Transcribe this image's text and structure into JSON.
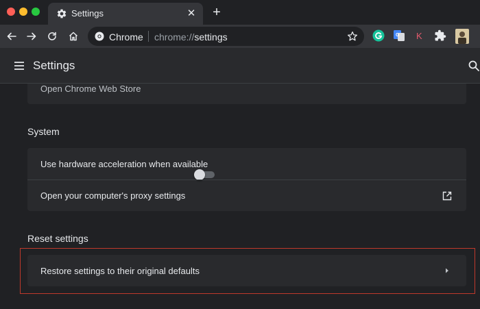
{
  "colors": {
    "background": "#202124",
    "toolbar": "#35363a",
    "card": "#292a2d",
    "highlight_border": "#c0392b",
    "traffic_red": "#fe5f57",
    "traffic_yellow": "#febc2e",
    "traffic_green": "#28c840"
  },
  "window": {
    "controls": [
      "close",
      "minimize",
      "zoom"
    ]
  },
  "tab": {
    "title": "Settings",
    "icon": "gear-icon",
    "close_label": "✕"
  },
  "new_tab_label": "+",
  "toolbar": {
    "buttons": [
      "back-arrow-icon",
      "forward-arrow-icon",
      "reload-icon",
      "home-icon"
    ],
    "omnibox": {
      "origin": "Chrome",
      "url_scheme": "chrome://",
      "url_host": "settings"
    },
    "extensions": [
      "grammarly-icon",
      "google-translate-icon",
      "k-extension-icon",
      "extensions-puzzle-icon",
      "profile-avatar-icon"
    ]
  },
  "header": {
    "title": "Settings"
  },
  "sections": {
    "previous_row": "Open Chrome Web Store",
    "system": {
      "title": "System",
      "rows": [
        {
          "label": "Use hardware acceleration when available",
          "control": "toggle",
          "enabled": false
        },
        {
          "label": "Open your computer's proxy settings",
          "control": "external-link-icon"
        }
      ]
    },
    "reset": {
      "title": "Reset settings",
      "rows": [
        {
          "label": "Restore settings to their original defaults",
          "control": "chevron-right-icon"
        }
      ]
    }
  }
}
